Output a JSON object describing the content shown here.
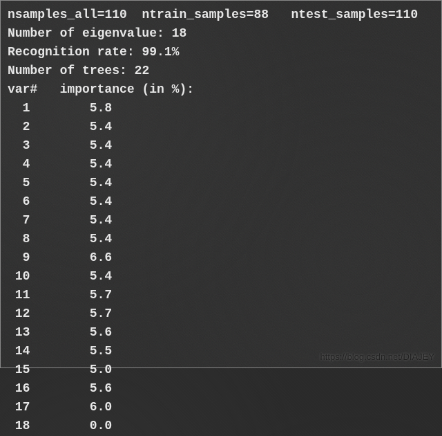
{
  "header": {
    "nsamples_all_label": "nsamples_all=",
    "nsamples_all_value": "110",
    "ntrain_samples_label": "ntrain_samples=",
    "ntrain_samples_value": "88",
    "ntest_samples_label": "ntest_samples=",
    "ntest_samples_value": "110"
  },
  "stats": {
    "eigenvalue_label": "Number of eigenvalue: ",
    "eigenvalue_value": "18",
    "recognition_label": "Recognition rate: ",
    "recognition_value": "99.1%",
    "trees_label": "Number of trees: ",
    "trees_value": "22"
  },
  "table": {
    "header_var": "var#",
    "header_importance": "importance (in %):",
    "rows": [
      {
        "var": "1",
        "importance": "5.8"
      },
      {
        "var": "2",
        "importance": "5.4"
      },
      {
        "var": "3",
        "importance": "5.4"
      },
      {
        "var": "4",
        "importance": "5.4"
      },
      {
        "var": "5",
        "importance": "5.4"
      },
      {
        "var": "6",
        "importance": "5.4"
      },
      {
        "var": "7",
        "importance": "5.4"
      },
      {
        "var": "8",
        "importance": "5.4"
      },
      {
        "var": "9",
        "importance": "6.6"
      },
      {
        "var": "10",
        "importance": "5.4"
      },
      {
        "var": "11",
        "importance": "5.7"
      },
      {
        "var": "12",
        "importance": "5.7"
      },
      {
        "var": "13",
        "importance": "5.6"
      },
      {
        "var": "14",
        "importance": "5.5"
      },
      {
        "var": "15",
        "importance": "5.0"
      },
      {
        "var": "16",
        "importance": "5.6"
      },
      {
        "var": "17",
        "importance": "6.0"
      },
      {
        "var": "18",
        "importance": "0.0"
      }
    ]
  },
  "watermark": "https://blog.csdn.net/DIAJEY"
}
